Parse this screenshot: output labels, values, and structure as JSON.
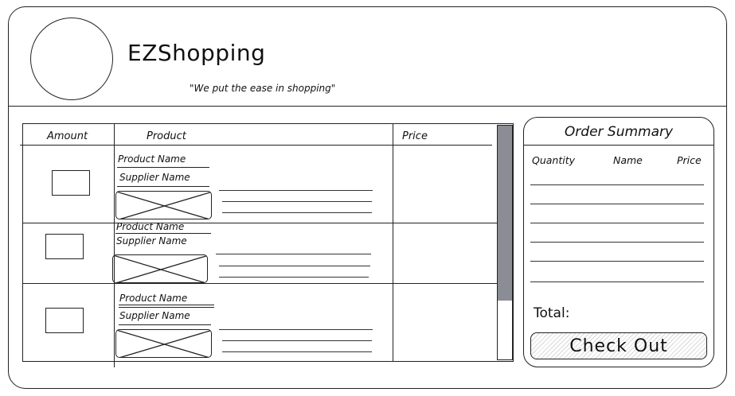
{
  "header": {
    "title": "EZShopping",
    "tagline": "\"We put the ease in shopping\""
  },
  "cart": {
    "columns": [
      "Amount",
      "Product",
      "Price"
    ],
    "items": [
      {
        "product_name": "Product Name",
        "supplier_name": "Supplier Name"
      },
      {
        "product_name": "Product Name",
        "supplier_name": "Supplier Name"
      },
      {
        "product_name": "Product Name",
        "supplier_name": "Supplier Name"
      }
    ]
  },
  "summary": {
    "title": "Order Summary",
    "columns": [
      "Quantity",
      "Name",
      "Price"
    ],
    "total_label": "Total:",
    "checkout_label": "Check Out"
  },
  "icons": [
    "logo-placeholder-icon",
    "image-placeholder-icon"
  ]
}
